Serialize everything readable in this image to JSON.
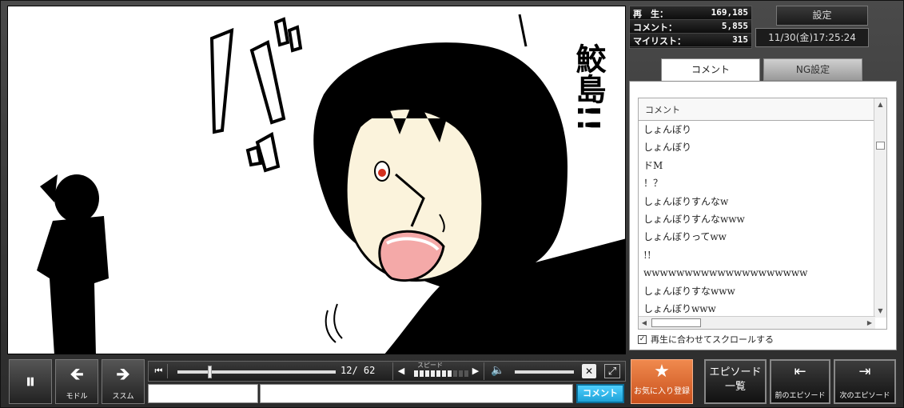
{
  "stats": {
    "views_label": "再　生：",
    "views_value": "169,185",
    "comments_label": "コメント：",
    "comments_value": "5,855",
    "mylist_label": "マイリスト：",
    "mylist_value": "315"
  },
  "settings_label": "設定",
  "datetime": "11/30(金)17:25:24",
  "tabs": [
    {
      "label": "コメント",
      "active": true
    },
    {
      "label": "NG設定",
      "active": false
    }
  ],
  "comment_list": {
    "header": "コメント",
    "items": [
      "しょんぼり",
      "しょんぼり",
      "ドM",
      "！？",
      "しょんぼりすんなw",
      "しょんぼりすんなwww",
      "しょんぼりってww",
      "!!",
      "wwwwwwwwwwwwwwwwwwww",
      "しょんぼりすなwww",
      "しょんぼりwww"
    ]
  },
  "sync_scroll_label": "再生に合わせてスクロールする",
  "video": {
    "sfx_text": "バ",
    "sfx_text2": "ッ",
    "name_text": "鮫島",
    "exclaim": "!!"
  },
  "controls": {
    "pause_icon": "⏸",
    "back_icon": "🡸",
    "back_label": "モドル",
    "fwd_icon": "🡺",
    "fwd_label": "ススム",
    "seek_start_icon": "⏮",
    "time": "12/ 62",
    "progress": 0.194,
    "speed_label": "スピード",
    "speed_dec": "◀",
    "speed_inc": "▶",
    "speed_level": 7,
    "speed_max": 10,
    "volume_icon": "🔈",
    "mute_icon": "✕",
    "fullscreen_icon": "⤢",
    "comment_submit": "コメント"
  },
  "fav": {
    "icon": "★",
    "label": "お気に入り登録"
  },
  "episodes": {
    "list_line1": "エピソード",
    "list_line2": "一覧",
    "prev_icon": "⇤",
    "prev_label": "前のエピソード",
    "next_icon": "⇥",
    "next_label": "次のエピソード"
  }
}
